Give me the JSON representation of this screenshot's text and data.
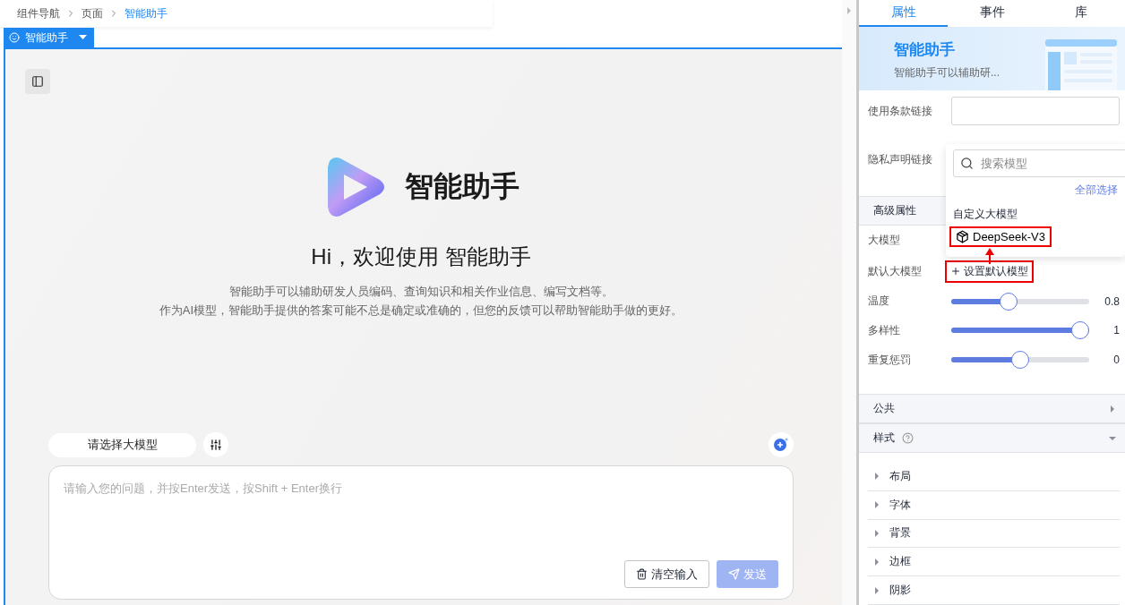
{
  "breadcrumb": [
    {
      "label": "组件导航",
      "selected": false
    },
    {
      "label": "页面",
      "selected": false
    },
    {
      "label": "智能助手",
      "selected": true
    }
  ],
  "component_tag": {
    "label": "智能助手"
  },
  "assistant": {
    "title": "智能助手",
    "greeting": "Hi，欢迎使用 智能助手",
    "description": [
      "智能助手可以辅助研发人员编码、查询知识和相关作业信息、编写文档等。",
      "作为AI模型，智能助手提供的答案可能不总是确定或准确的，但您的反馈可以帮助智能助手做的更好。"
    ],
    "model_select": "请选择大模型",
    "input": {
      "placeholder": "请输入您的问题，并按Enter发送，按Shift + Enter换行"
    },
    "buttons": [
      {
        "kind": "clear",
        "label": "清空输入",
        "disabled": false
      },
      {
        "kind": "send",
        "label": "发送",
        "disabled": true
      }
    ]
  },
  "panel": {
    "tabs": [
      {
        "label": "属性",
        "selected": true
      },
      {
        "label": "事件",
        "selected": false
      },
      {
        "label": "库",
        "selected": false
      }
    ],
    "banner": {
      "title": "智能助手",
      "subtitle": "智能助手可以辅助研..."
    },
    "fields": [
      {
        "label": "使用条款链接"
      },
      {
        "label": "隐私声明链接"
      }
    ],
    "advanced": {
      "title": "高级属性",
      "model_label": "大模型",
      "default_label": "默认大模型",
      "default_link": {
        "label": "设置默认模型",
        "annotated": true
      },
      "sliders": [
        {
          "label": "温度",
          "level": 0.4,
          "reading": "0.8"
        },
        {
          "label": "多样性",
          "level": 1,
          "reading": "1"
        },
        {
          "label": "重复惩罚",
          "level": 0.5,
          "reading": "0"
        }
      ]
    },
    "sections": [
      {
        "title": "公共",
        "expanded": false,
        "help": false
      },
      {
        "title": "样式",
        "expanded": true,
        "help": true
      }
    ],
    "style_items": [
      {
        "label": "布局",
        "expanded": false
      },
      {
        "label": "字体",
        "expanded": false
      },
      {
        "label": "背景",
        "expanded": false
      },
      {
        "label": "边框",
        "expanded": false
      },
      {
        "label": "阴影",
        "expanded": false
      }
    ],
    "dropdown": {
      "search": {
        "placeholder": "搜索模型"
      },
      "select_all": "全部选择",
      "group": "自定义大模型",
      "options": [
        {
          "label": "DeepSeek-V3",
          "annotated": true
        }
      ]
    }
  }
}
